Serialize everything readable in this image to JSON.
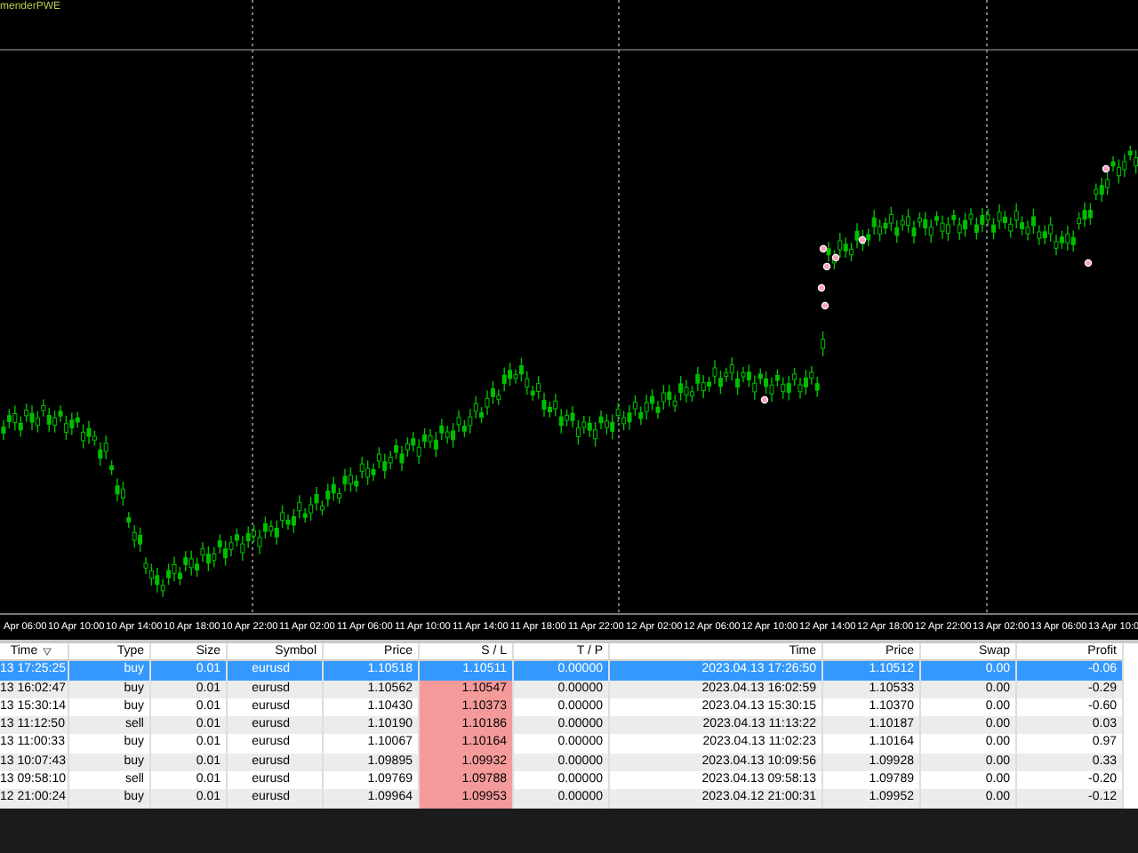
{
  "chart": {
    "title": "menderPWE",
    "time_axis": [
      "Apr 06:00",
      "10 Apr 10:00",
      "10 Apr 14:00",
      "10 Apr 18:00",
      "10 Apr 22:00",
      "11 Apr 02:00",
      "11 Apr 06:00",
      "11 Apr 10:00",
      "11 Apr 14:00",
      "11 Apr 18:00",
      "11 Apr 22:00",
      "12 Apr 02:00",
      "12 Apr 06:00",
      "12 Apr 10:00",
      "12 Apr 14:00",
      "12 Apr 18:00",
      "12 Apr 22:00",
      "13 Apr 02:00",
      "13 Apr 06:00",
      "13 Apr 10:0"
    ]
  },
  "trades": {
    "columns": [
      "Time",
      "Type",
      "Size",
      "Symbol",
      "Price",
      "S / L",
      "T / P",
      "Time",
      "Price",
      "Swap",
      "Profit"
    ],
    "rows": [
      {
        "selected": true,
        "cells": [
          "13 17:25:25",
          "buy",
          "0.01",
          "eurusd",
          "1.10518",
          "1.10511",
          "0.00000",
          "2023.04.13 17:26:50",
          "1.10512",
          "0.00",
          "-0.06"
        ]
      },
      {
        "selected": false,
        "cells": [
          "13 16:02:47",
          "buy",
          "0.01",
          "eurusd",
          "1.10562",
          "1.10547",
          "0.00000",
          "2023.04.13 16:02:59",
          "1.10533",
          "0.00",
          "-0.29"
        ]
      },
      {
        "selected": false,
        "cells": [
          "13 15:30:14",
          "buy",
          "0.01",
          "eurusd",
          "1.10430",
          "1.10373",
          "0.00000",
          "2023.04.13 15:30:15",
          "1.10370",
          "0.00",
          "-0.60"
        ]
      },
      {
        "selected": false,
        "cells": [
          "13 11:12:50",
          "sell",
          "0.01",
          "eurusd",
          "1.10190",
          "1.10186",
          "0.00000",
          "2023.04.13 11:13:22",
          "1.10187",
          "0.00",
          "0.03"
        ]
      },
      {
        "selected": false,
        "cells": [
          "13 11:00:33",
          "buy",
          "0.01",
          "eurusd",
          "1.10067",
          "1.10164",
          "0.00000",
          "2023.04.13 11:02:23",
          "1.10164",
          "0.00",
          "0.97"
        ]
      },
      {
        "selected": false,
        "cells": [
          "13 10:07:43",
          "buy",
          "0.01",
          "eurusd",
          "1.09895",
          "1.09932",
          "0.00000",
          "2023.04.13 10:09:56",
          "1.09928",
          "0.00",
          "0.33"
        ]
      },
      {
        "selected": false,
        "cells": [
          "13 09:58:10",
          "sell",
          "0.01",
          "eurusd",
          "1.09769",
          "1.09788",
          "0.00000",
          "2023.04.13 09:58:13",
          "1.09789",
          "0.00",
          "-0.20"
        ]
      },
      {
        "selected": false,
        "cells": [
          "12 21:00:24",
          "buy",
          "0.01",
          "eurusd",
          "1.09964",
          "1.09953",
          "0.00000",
          "2023.04.12 21:00:31",
          "1.09952",
          "0.00",
          "-0.12"
        ]
      }
    ]
  }
}
